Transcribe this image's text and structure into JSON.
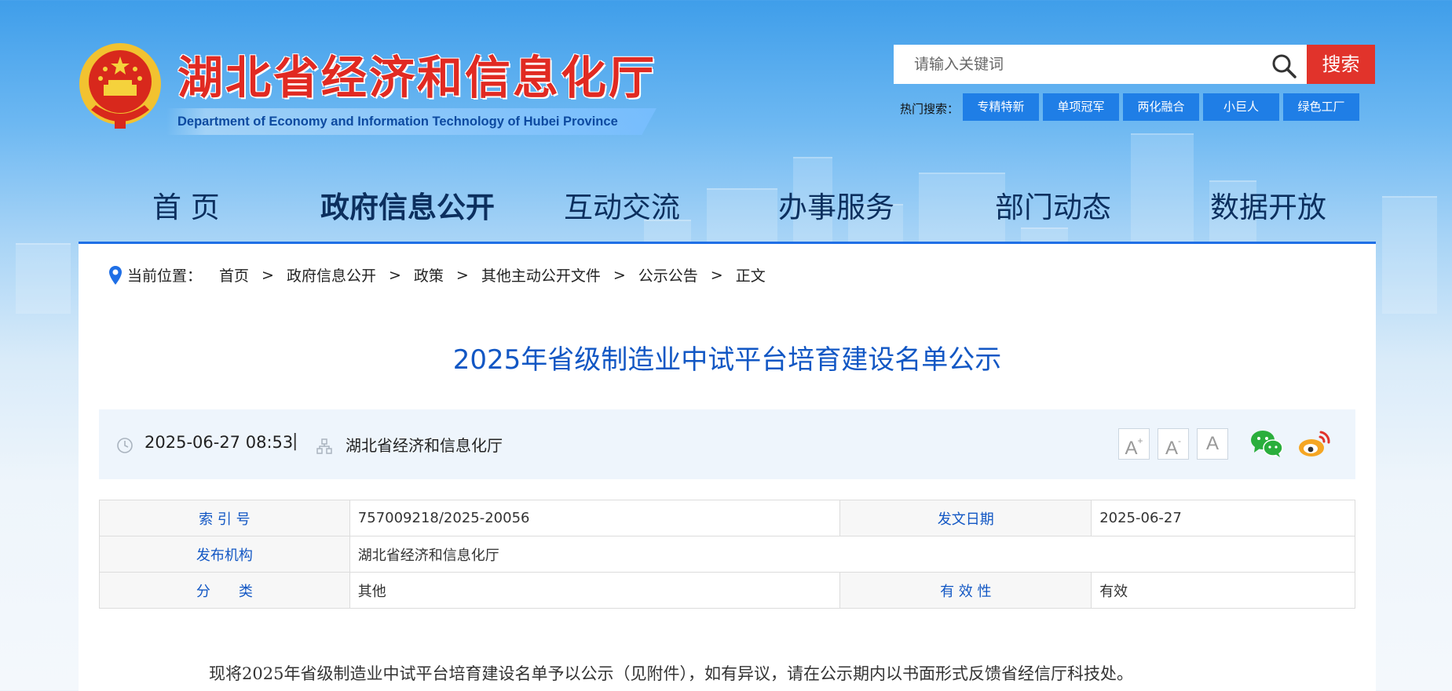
{
  "header": {
    "site_title": "湖北省经济和信息化厅",
    "site_subtitle": "Department of Economy and Information Technology of Hubei Province"
  },
  "search": {
    "placeholder": "请输入关键词",
    "button_label": "搜索",
    "hot_label": "热门搜索：",
    "hot_tags": [
      "专精特新",
      "单项冠军",
      "两化融合",
      "小巨人",
      "绿色工厂"
    ]
  },
  "nav": {
    "items": [
      "首 页",
      "政府信息公开",
      "互动交流",
      "办事服务",
      "部门动态",
      "数据开放"
    ],
    "active": "政府信息公开"
  },
  "breadcrumb": {
    "label": "当前位置：",
    "items": [
      "首页",
      "政府信息公开",
      "政策",
      "其他主动公开文件",
      "公示公告",
      "正文"
    ],
    "separator": ">"
  },
  "article": {
    "title": "2025年省级制造业中试平台培育建设名单公示",
    "datetime": "2025-06-27 08:53",
    "divider": "|",
    "source": "湖北省经济和信息化厅",
    "font_controls": [
      "A",
      "A",
      "A"
    ],
    "font_control_marks": [
      "+",
      "-",
      ""
    ],
    "body": "现将2025年省级制造业中试平台培育建设名单予以公示（见附件），如有异议，请在公示期内以书面形式反馈省经信厅科技处。"
  },
  "info_table": {
    "index_label": "索 引 号",
    "index_value": "757009218/2025-20056",
    "date_label": "发文日期",
    "date_value": "2025-06-27",
    "org_label": "发布机构",
    "org_value": "湖北省经济和信息化厅",
    "category_label": "分　　类",
    "category_value": "其他",
    "validity_label": "有 效 性",
    "validity_value": "有效"
  },
  "colors": {
    "accent_blue": "#1f7ee6",
    "title_blue": "#1257c4",
    "search_red": "#e1332b",
    "site_title_red": "#e12a22",
    "wechat_green": "#2aae3c",
    "weibo_orange": "#f5a623"
  },
  "icons": [
    "national-emblem-icon",
    "search-icon",
    "location-pin-icon",
    "clock-icon",
    "org-icon",
    "wechat-icon",
    "weibo-icon"
  ]
}
